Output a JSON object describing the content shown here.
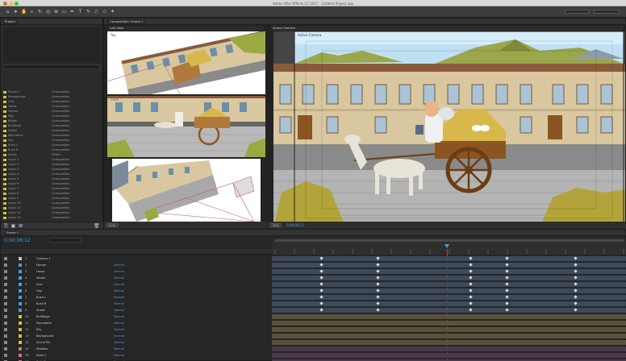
{
  "window": {
    "title": "Adobe After Effects CC 2017 - Untitled Project.aep"
  },
  "project_panel": {
    "tab": "Project",
    "items": [
      {
        "name": "Scene 1",
        "type": "Composition",
        "color": "#d8c23a"
      },
      {
        "name": "Background",
        "type": "Composition",
        "color": "#d8c23a"
      },
      {
        "name": "Cart",
        "type": "Composition",
        "color": "#d8c23a"
      },
      {
        "name": "Horse",
        "type": "Composition",
        "color": "#d8c23a"
      },
      {
        "name": "Farmer",
        "type": "Composition",
        "color": "#d8c23a"
      },
      {
        "name": "Hay",
        "type": "Composition",
        "color": "#d8c23a"
      },
      {
        "name": "Wheel",
        "type": "Composition",
        "color": "#d8c23a"
      },
      {
        "name": "Buildings",
        "type": "Composition",
        "color": "#d8c23a"
      },
      {
        "name": "Street",
        "type": "Composition",
        "color": "#d8c23a"
      },
      {
        "name": "Mountains",
        "type": "Composition",
        "color": "#d8c23a"
      },
      {
        "name": "Sky",
        "type": "Composition",
        "color": "#d8c23a"
      },
      {
        "name": "Bush L",
        "type": "Composition",
        "color": "#d8c23a"
      },
      {
        "name": "Bush R",
        "type": "Composition",
        "color": "#d8c23a"
      },
      {
        "name": "Solids",
        "type": "Folder",
        "color": "#d8c23a"
      },
      {
        "name": "Layer 1",
        "type": "Composition",
        "color": "#d8c23a"
      },
      {
        "name": "Layer 2",
        "type": "Composition",
        "color": "#d8c23a"
      },
      {
        "name": "Layer 3",
        "type": "Composition",
        "color": "#d8c23a"
      },
      {
        "name": "Layer 4",
        "type": "Composition",
        "color": "#d8c23a"
      },
      {
        "name": "Layer 5",
        "type": "Composition",
        "color": "#d8c23a"
      },
      {
        "name": "Layer 6",
        "type": "Composition",
        "color": "#d8c23a"
      },
      {
        "name": "Layer 7",
        "type": "Composition",
        "color": "#d8c23a"
      },
      {
        "name": "Layer 8",
        "type": "Composition",
        "color": "#d8c23a"
      },
      {
        "name": "Layer 9",
        "type": "Composition",
        "color": "#d8c23a"
      },
      {
        "name": "Layer 10",
        "type": "Composition",
        "color": "#d8c23a"
      },
      {
        "name": "Layer 11",
        "type": "Composition",
        "color": "#d8c23a"
      },
      {
        "name": "Layer 12",
        "type": "Composition",
        "color": "#d8c23a"
      },
      {
        "name": "Layer 13",
        "type": "Composition",
        "color": "#d8c23a"
      }
    ]
  },
  "composition_panel": {
    "tab": "Composition: Scene 1",
    "views": [
      "Left View",
      "Active Camera"
    ],
    "zoom": "50%",
    "timecode": "0;00;06;12",
    "view_labels": [
      "Top",
      "Front",
      "Active Camera"
    ]
  },
  "timeline": {
    "comp_name": "Scene 1",
    "timecode": "0;00;06;12",
    "playhead_fraction": 0.5,
    "layers": [
      {
        "num": "1",
        "name": "Camera 1",
        "mode": "",
        "color": "#c3c3c3"
      },
      {
        "name": "Farmer",
        "num": "2",
        "mode": "Normal",
        "color": "#4a9de0"
      },
      {
        "name": "Horse",
        "num": "3",
        "mode": "Normal",
        "color": "#4a9de0"
      },
      {
        "name": "Wheel",
        "num": "4",
        "mode": "Normal",
        "color": "#4a9de0"
      },
      {
        "name": "Cart",
        "num": "5",
        "mode": "Normal",
        "color": "#4a9de0"
      },
      {
        "name": "Hay",
        "num": "6",
        "mode": "Normal",
        "color": "#4a9de0"
      },
      {
        "name": "Bush L",
        "num": "7",
        "mode": "Normal",
        "color": "#4a9de0"
      },
      {
        "name": "Bush R",
        "num": "8",
        "mode": "Normal",
        "color": "#4a9de0"
      },
      {
        "name": "Street",
        "num": "9",
        "mode": "Normal",
        "color": "#4a9de0"
      },
      {
        "name": "Buildings",
        "num": "10",
        "mode": "Normal",
        "color": "#d8c23a"
      },
      {
        "name": "Mountains",
        "num": "11",
        "mode": "Normal",
        "color": "#d8c23a"
      },
      {
        "name": "Sky",
        "num": "12",
        "mode": "Normal",
        "color": "#d8c23a"
      },
      {
        "name": "Background",
        "num": "13",
        "mode": "Normal",
        "color": "#d8c23a"
      },
      {
        "name": "Scene BG",
        "num": "14",
        "mode": "Normal",
        "color": "#d8c23a"
      },
      {
        "name": "Shadow",
        "num": "15",
        "mode": "Normal",
        "color": "#c77"
      },
      {
        "name": "Solid 1",
        "num": "16",
        "mode": "Normal",
        "color": "#c77"
      },
      {
        "name": "Solid 2",
        "num": "17",
        "mode": "Normal",
        "color": "#c77"
      }
    ]
  }
}
